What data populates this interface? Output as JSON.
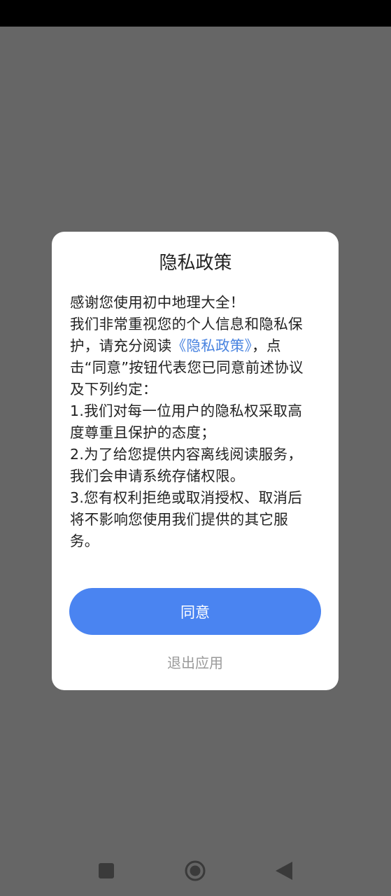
{
  "dialog": {
    "title": "隐私政策",
    "greeting": "感谢您使用初中地理大全！",
    "intro_before_link": "我们非常重视您的个人信息和隐私保护，请充分阅读",
    "policy_link": "《隐私政策》",
    "intro_after_link": "，点击“同意”按钮代表您已同意前述协议及下列约定：",
    "items": [
      "1.我们对每一位用户的隐私权采取高度尊重且保护的态度；",
      "2.为了给您提供内容离线阅读服务，我们会申请系统存储权限。",
      "3.您有权利拒绝或取消授权、取消后将不影响您使用我们提供的其它服务。"
    ],
    "agree_label": "同意",
    "exit_label": "退出应用"
  },
  "nav_bar": {
    "icons": [
      "recent-apps-icon",
      "home-icon",
      "back-icon"
    ]
  },
  "colors": {
    "overlay": "#666666",
    "accent": "#4a84f1",
    "link": "#4a84e0",
    "muted": "#9a9a9a"
  }
}
